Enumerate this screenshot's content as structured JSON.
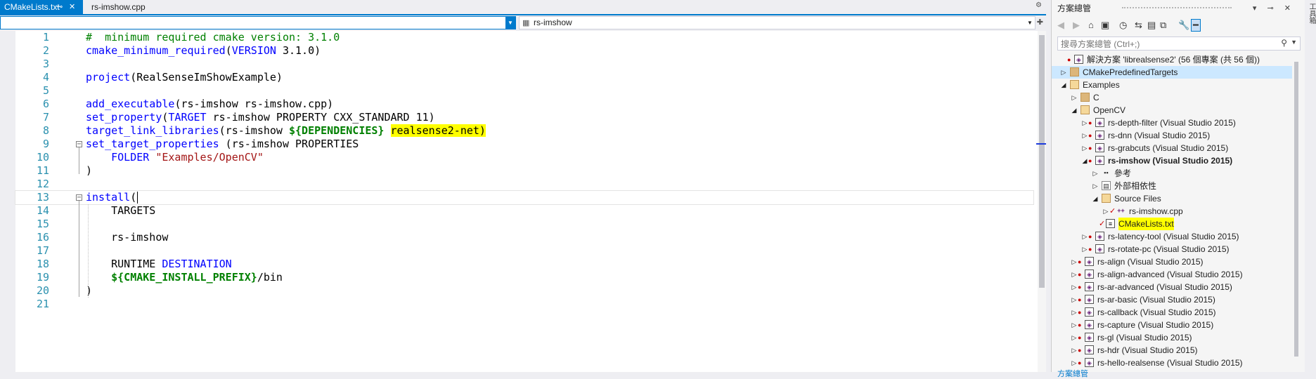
{
  "tabs": {
    "active_label": "CMakeLists.txt",
    "pin_icon": "pin-icon",
    "close_icon": "close-icon",
    "inactive_label": "rs-imshow.cpp"
  },
  "nav": {
    "left_value": "",
    "right_value": "rs-imshow"
  },
  "code_lines": [
    {
      "n": "1",
      "segments": [
        {
          "t": "#  minimum required cmake version: 3.1.0",
          "c": "cmt"
        }
      ]
    },
    {
      "n": "2",
      "segments": [
        {
          "t": "cmake_minimum_required",
          "c": "kw"
        },
        {
          "t": "(",
          "c": ""
        },
        {
          "t": "VERSION",
          "c": "kw"
        },
        {
          "t": " 3.1.0)",
          "c": ""
        }
      ]
    },
    {
      "n": "3",
      "segments": []
    },
    {
      "n": "4",
      "segments": [
        {
          "t": "project",
          "c": "kw"
        },
        {
          "t": "(RealSenseImShowExample)",
          "c": ""
        }
      ]
    },
    {
      "n": "5",
      "segments": []
    },
    {
      "n": "6",
      "segments": [
        {
          "t": "add_executable",
          "c": "kw"
        },
        {
          "t": "(rs-imshow rs-imshow.cpp)",
          "c": ""
        }
      ]
    },
    {
      "n": "7",
      "segments": [
        {
          "t": "set_property",
          "c": "kw"
        },
        {
          "t": "(",
          "c": ""
        },
        {
          "t": "TARGET",
          "c": "kw"
        },
        {
          "t": " rs-imshow PROPERTY CXX_STANDARD 11)",
          "c": ""
        }
      ]
    },
    {
      "n": "8",
      "segments": [
        {
          "t": "target_link_libraries",
          "c": "kw"
        },
        {
          "t": "(rs-imshow ",
          "c": ""
        },
        {
          "t": "${DEPENDENCIES}",
          "c": "var"
        },
        {
          "t": " ",
          "c": ""
        },
        {
          "t": "realsense2-net)",
          "c": "hl"
        }
      ]
    },
    {
      "n": "9",
      "fold": true,
      "segments": [
        {
          "t": "set_target_properties",
          "c": "kw"
        },
        {
          "t": " (rs-imshow PROPERTIES",
          "c": ""
        }
      ]
    },
    {
      "n": "10",
      "segments": [
        {
          "t": "    FOLDER ",
          "c": "kw"
        },
        {
          "t": "\"Examples/OpenCV\"",
          "c": "str"
        }
      ]
    },
    {
      "n": "11",
      "segments": [
        {
          "t": ")",
          "c": ""
        }
      ]
    },
    {
      "n": "12",
      "segments": []
    },
    {
      "n": "13",
      "fold": true,
      "current": true,
      "segments": [
        {
          "t": "install",
          "c": "kw"
        },
        {
          "t": "(",
          "c": ""
        }
      ]
    },
    {
      "n": "14",
      "segments": [
        {
          "t": "    TARGETS",
          "c": ""
        }
      ]
    },
    {
      "n": "15",
      "segments": []
    },
    {
      "n": "16",
      "segments": [
        {
          "t": "    rs-imshow",
          "c": ""
        }
      ]
    },
    {
      "n": "17",
      "segments": []
    },
    {
      "n": "18",
      "segments": [
        {
          "t": "    RUNTIME ",
          "c": ""
        },
        {
          "t": "DESTINATION",
          "c": "kw"
        }
      ]
    },
    {
      "n": "19",
      "segments": [
        {
          "t": "    ",
          "c": ""
        },
        {
          "t": "${CMAKE_INSTALL_PREFIX}",
          "c": "var"
        },
        {
          "t": "/bin",
          "c": ""
        }
      ]
    },
    {
      "n": "20",
      "segments": [
        {
          "t": ")",
          "c": ""
        }
      ]
    },
    {
      "n": "21",
      "segments": []
    }
  ],
  "solution_explorer": {
    "title": "方案總管",
    "search_placeholder": "搜尋方案總管 (Ctrl+;)",
    "side_tab": "工具箱",
    "bottom_tab": "方案總管",
    "nodes": [
      {
        "label": "解決方案 'librealsense2' (56 個專案 (共 56 個))",
        "icon": "sln",
        "exp": "",
        "level": 0,
        "dot": true
      },
      {
        "label": "CMakePredefinedTargets",
        "icon": "folder",
        "exp": "▷",
        "level": 0,
        "sel": true
      },
      {
        "label": "Examples",
        "icon": "ofolder",
        "exp": "◢",
        "level": 0
      },
      {
        "label": "C",
        "icon": "folder",
        "exp": "▷",
        "level": 1
      },
      {
        "label": "OpenCV",
        "icon": "ofolder",
        "exp": "◢",
        "level": 1
      },
      {
        "label": "rs-depth-filter (Visual Studio 2015)",
        "icon": "proj",
        "exp": "▷",
        "level": 2,
        "dot": true
      },
      {
        "label": "rs-dnn (Visual Studio 2015)",
        "icon": "proj",
        "exp": "▷",
        "level": 2,
        "dot": true
      },
      {
        "label": "rs-grabcuts (Visual Studio 2015)",
        "icon": "proj",
        "exp": "▷",
        "level": 2,
        "dot": true
      },
      {
        "label": "rs-imshow (Visual Studio 2015)",
        "icon": "proj",
        "exp": "◢",
        "level": 2,
        "dot": true,
        "bold": true
      },
      {
        "label": "參考",
        "icon": "ref",
        "exp": "▷",
        "level": 3
      },
      {
        "label": "外部相依性",
        "icon": "ext",
        "exp": "▷",
        "level": 3
      },
      {
        "label": "Source Files",
        "icon": "src",
        "exp": "◢",
        "level": 3
      },
      {
        "label": "rs-imshow.cpp",
        "icon": "cpp",
        "exp": "▷",
        "level": 4,
        "check": true
      },
      {
        "label": "CMakeLists.txt",
        "icon": "txt",
        "exp": "",
        "level": 3,
        "check": true,
        "hl": true
      },
      {
        "label": "rs-latency-tool (Visual Studio 2015)",
        "icon": "proj",
        "exp": "▷",
        "level": 2,
        "dot": true
      },
      {
        "label": "rs-rotate-pc (Visual Studio 2015)",
        "icon": "proj",
        "exp": "▷",
        "level": 2,
        "dot": true
      },
      {
        "label": "rs-align (Visual Studio 2015)",
        "icon": "proj",
        "exp": "▷",
        "level": 1,
        "dot": true
      },
      {
        "label": "rs-align-advanced (Visual Studio 2015)",
        "icon": "proj",
        "exp": "▷",
        "level": 1,
        "dot": true
      },
      {
        "label": "rs-ar-advanced (Visual Studio 2015)",
        "icon": "proj",
        "exp": "▷",
        "level": 1,
        "dot": true
      },
      {
        "label": "rs-ar-basic (Visual Studio 2015)",
        "icon": "proj",
        "exp": "▷",
        "level": 1,
        "dot": true
      },
      {
        "label": "rs-callback (Visual Studio 2015)",
        "icon": "proj",
        "exp": "▷",
        "level": 1,
        "dot": true
      },
      {
        "label": "rs-capture (Visual Studio 2015)",
        "icon": "proj",
        "exp": "▷",
        "level": 1,
        "dot": true
      },
      {
        "label": "rs-gl (Visual Studio 2015)",
        "icon": "proj",
        "exp": "▷",
        "level": 1,
        "dot": true
      },
      {
        "label": "rs-hdr (Visual Studio 2015)",
        "icon": "proj",
        "exp": "▷",
        "level": 1,
        "dot": true
      },
      {
        "label": "rs-hello-realsense (Visual Studio 2015)",
        "icon": "proj",
        "exp": "▷",
        "level": 1,
        "dot": true
      }
    ]
  },
  "colors": {
    "accent": "#007acc",
    "keyword": "#0000ff",
    "comment": "#008000",
    "string": "#a31515",
    "highlight": "#ffff00",
    "line_number": "#2b91af"
  }
}
